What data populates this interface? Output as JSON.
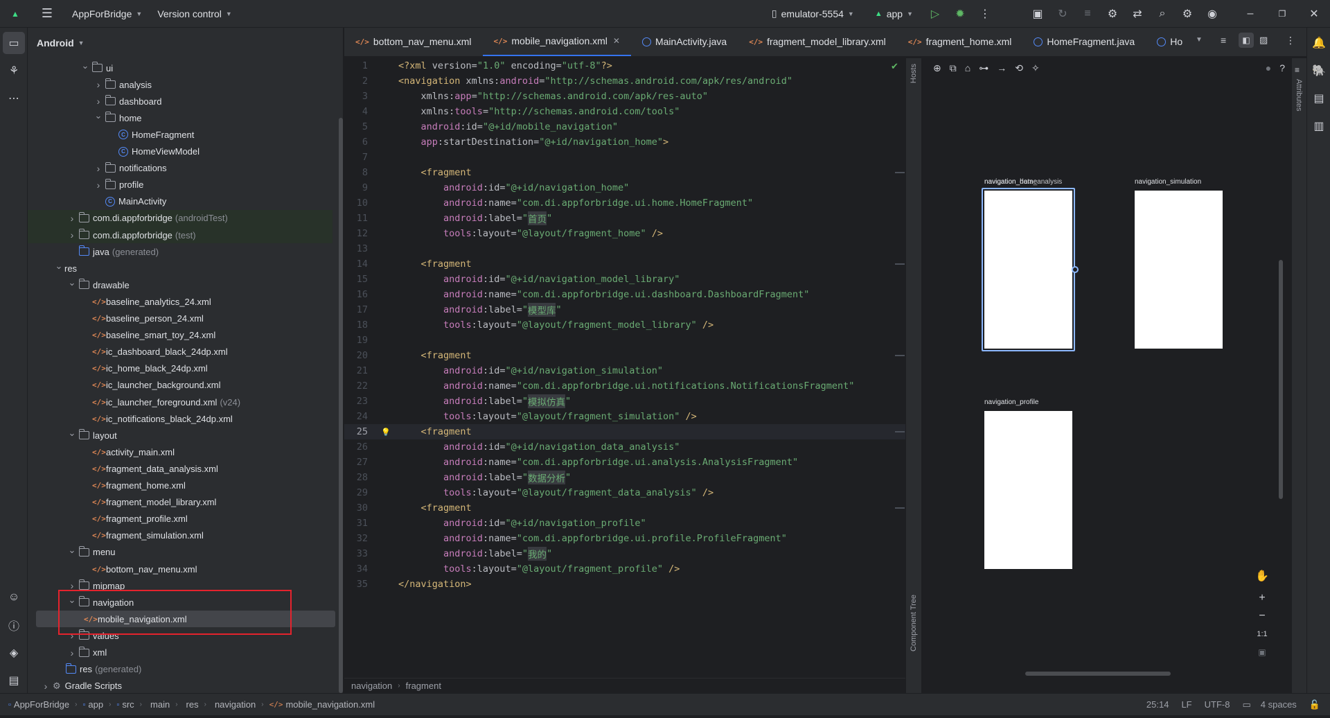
{
  "titlebar": {
    "project": "AppForBridge",
    "vcs": "Version control",
    "device": "emulator-5554",
    "run_config": "app"
  },
  "project_panel": {
    "view": "Android",
    "tree": [
      {
        "label": "ui",
        "level": 3,
        "kind": "folder",
        "state": "open"
      },
      {
        "label": "analysis",
        "level": 4,
        "kind": "folder",
        "state": "closed"
      },
      {
        "label": "dashboard",
        "level": 4,
        "kind": "folder",
        "state": "closed"
      },
      {
        "label": "home",
        "level": 4,
        "kind": "folder",
        "state": "open"
      },
      {
        "label": "HomeFragment",
        "level": 5,
        "kind": "class"
      },
      {
        "label": "HomeViewModel",
        "level": 5,
        "kind": "class"
      },
      {
        "label": "notifications",
        "level": 4,
        "kind": "folder",
        "state": "closed"
      },
      {
        "label": "profile",
        "level": 4,
        "kind": "folder",
        "state": "closed"
      },
      {
        "label": "MainActivity",
        "level": 4,
        "kind": "class"
      },
      {
        "label": "com.di.appforbridge",
        "suffix": "(androidTest)",
        "level": 2,
        "kind": "folder",
        "state": "closed",
        "green": true
      },
      {
        "label": "com.di.appforbridge",
        "suffix": "(test)",
        "level": 2,
        "kind": "folder",
        "state": "closed",
        "green": true
      },
      {
        "label": "java",
        "suffix": "(generated)",
        "level": 2,
        "kind": "folder-blue"
      },
      {
        "label": "res",
        "level": 1,
        "kind": "none",
        "state": "open"
      },
      {
        "label": "drawable",
        "level": 2,
        "kind": "folder",
        "state": "open"
      },
      {
        "label": "baseline_analytics_24.xml",
        "level": 3,
        "kind": "xml"
      },
      {
        "label": "baseline_person_24.xml",
        "level": 3,
        "kind": "xml"
      },
      {
        "label": "baseline_smart_toy_24.xml",
        "level": 3,
        "kind": "xml"
      },
      {
        "label": "ic_dashboard_black_24dp.xml",
        "level": 3,
        "kind": "xml"
      },
      {
        "label": "ic_home_black_24dp.xml",
        "level": 3,
        "kind": "xml"
      },
      {
        "label": "ic_launcher_background.xml",
        "level": 3,
        "kind": "xml"
      },
      {
        "label": "ic_launcher_foreground.xml",
        "suffix": "(v24)",
        "level": 3,
        "kind": "xml"
      },
      {
        "label": "ic_notifications_black_24dp.xml",
        "level": 3,
        "kind": "xml"
      },
      {
        "label": "layout",
        "level": 2,
        "kind": "folder",
        "state": "open"
      },
      {
        "label": "activity_main.xml",
        "level": 3,
        "kind": "xml"
      },
      {
        "label": "fragment_data_analysis.xml",
        "level": 3,
        "kind": "xml"
      },
      {
        "label": "fragment_home.xml",
        "level": 3,
        "kind": "xml"
      },
      {
        "label": "fragment_model_library.xml",
        "level": 3,
        "kind": "xml"
      },
      {
        "label": "fragment_profile.xml",
        "level": 3,
        "kind": "xml"
      },
      {
        "label": "fragment_simulation.xml",
        "level": 3,
        "kind": "xml"
      },
      {
        "label": "menu",
        "level": 2,
        "kind": "folder",
        "state": "open"
      },
      {
        "label": "bottom_nav_menu.xml",
        "level": 3,
        "kind": "xml"
      },
      {
        "label": "mipmap",
        "level": 2,
        "kind": "folder",
        "state": "closed"
      },
      {
        "label": "navigation",
        "level": 2,
        "kind": "folder",
        "state": "open"
      },
      {
        "label": "mobile_navigation.xml",
        "level": 3,
        "kind": "xml",
        "selected": true
      },
      {
        "label": "values",
        "level": 2,
        "kind": "folder",
        "state": "closed"
      },
      {
        "label": "xml",
        "level": 2,
        "kind": "folder",
        "state": "closed"
      },
      {
        "label": "res",
        "suffix": "(generated)",
        "level": 1,
        "kind": "folder-blue"
      },
      {
        "label": "Gradle Scripts",
        "level": 0,
        "kind": "gradle",
        "state": "closed"
      }
    ]
  },
  "editor": {
    "tabs": [
      {
        "label": "bottom_nav_menu.xml",
        "kind": "xml"
      },
      {
        "label": "mobile_navigation.xml",
        "kind": "xml",
        "active": true,
        "close": "✕"
      },
      {
        "label": "MainActivity.java",
        "kind": "class"
      },
      {
        "label": "fragment_model_library.xml",
        "kind": "xml"
      },
      {
        "label": "fragment_home.xml",
        "kind": "xml"
      },
      {
        "label": "HomeFragment.java",
        "kind": "class"
      },
      {
        "label": "Ho",
        "kind": "class"
      }
    ],
    "current_line": 25,
    "breadcrumb": [
      "navigation",
      "fragment"
    ]
  },
  "code_lines": [
    [
      [
        "tg",
        "<?xml "
      ],
      [
        "at",
        "version="
      ],
      [
        "st",
        "\"1.0\" "
      ],
      [
        "at",
        "encoding="
      ],
      [
        "st",
        "\"utf-8\""
      ],
      [
        "tg",
        "?>"
      ]
    ],
    [
      [
        "tg",
        "<navigation "
      ],
      [
        "at",
        "xmlns:"
      ],
      [
        "ns",
        "android"
      ],
      [
        "at",
        "="
      ],
      [
        "st",
        "\"http://schemas.android.com/apk/res/android\""
      ]
    ],
    [
      [
        "txt",
        "    "
      ],
      [
        "at",
        "xmlns:"
      ],
      [
        "ns",
        "app"
      ],
      [
        "at",
        "="
      ],
      [
        "st",
        "\"http://schemas.android.com/apk/res-auto\""
      ]
    ],
    [
      [
        "txt",
        "    "
      ],
      [
        "at",
        "xmlns:"
      ],
      [
        "ns",
        "tools"
      ],
      [
        "at",
        "="
      ],
      [
        "st",
        "\"http://schemas.android.com/tools\""
      ]
    ],
    [
      [
        "txt",
        "    "
      ],
      [
        "ns",
        "android"
      ],
      [
        "at",
        ":id="
      ],
      [
        "st",
        "\"@+id/mobile_navigation\""
      ]
    ],
    [
      [
        "txt",
        "    "
      ],
      [
        "ns",
        "app"
      ],
      [
        "at",
        ":startDestination="
      ],
      [
        "st",
        "\"@+id/navigation_home\""
      ],
      [
        "tg",
        ">"
      ]
    ],
    [],
    [
      [
        "txt",
        "    "
      ],
      [
        "tg",
        "<fragment"
      ]
    ],
    [
      [
        "txt",
        "        "
      ],
      [
        "ns",
        "android"
      ],
      [
        "at",
        ":id="
      ],
      [
        "st",
        "\"@+id/navigation_home\""
      ]
    ],
    [
      [
        "txt",
        "        "
      ],
      [
        "ns",
        "android"
      ],
      [
        "at",
        ":name="
      ],
      [
        "st",
        "\"com.di.appforbridge.ui.home.HomeFragment\""
      ]
    ],
    [
      [
        "txt",
        "        "
      ],
      [
        "ns",
        "android"
      ],
      [
        "at",
        ":label="
      ],
      [
        "st",
        "\""
      ],
      [
        "ch",
        "首页"
      ],
      [
        "st",
        "\""
      ]
    ],
    [
      [
        "txt",
        "        "
      ],
      [
        "ns",
        "tools"
      ],
      [
        "at",
        ":layout="
      ],
      [
        "st",
        "\"@layout/fragment_home\" "
      ],
      [
        "tg",
        "/>"
      ]
    ],
    [],
    [
      [
        "txt",
        "    "
      ],
      [
        "tg",
        "<fragment"
      ]
    ],
    [
      [
        "txt",
        "        "
      ],
      [
        "ns",
        "android"
      ],
      [
        "at",
        ":id="
      ],
      [
        "st",
        "\"@+id/navigation_model_library\""
      ]
    ],
    [
      [
        "txt",
        "        "
      ],
      [
        "ns",
        "android"
      ],
      [
        "at",
        ":name="
      ],
      [
        "st",
        "\"com.di.appforbridge.ui.dashboard.DashboardFragment\""
      ]
    ],
    [
      [
        "txt",
        "        "
      ],
      [
        "ns",
        "android"
      ],
      [
        "at",
        ":label="
      ],
      [
        "st",
        "\""
      ],
      [
        "ch",
        "模型库"
      ],
      [
        "st",
        "\""
      ]
    ],
    [
      [
        "txt",
        "        "
      ],
      [
        "ns",
        "tools"
      ],
      [
        "at",
        ":layout="
      ],
      [
        "st",
        "\"@layout/fragment_model_library\" "
      ],
      [
        "tg",
        "/>"
      ]
    ],
    [],
    [
      [
        "txt",
        "    "
      ],
      [
        "tg",
        "<fragment"
      ]
    ],
    [
      [
        "txt",
        "        "
      ],
      [
        "ns",
        "android"
      ],
      [
        "at",
        ":id="
      ],
      [
        "st",
        "\"@+id/navigation_simulation\""
      ]
    ],
    [
      [
        "txt",
        "        "
      ],
      [
        "ns",
        "android"
      ],
      [
        "at",
        ":name="
      ],
      [
        "st",
        "\"com.di.appforbridge.ui.notifications.NotificationsFragment\""
      ]
    ],
    [
      [
        "txt",
        "        "
      ],
      [
        "ns",
        "android"
      ],
      [
        "at",
        ":label="
      ],
      [
        "st",
        "\""
      ],
      [
        "ch",
        "模拟仿真"
      ],
      [
        "st",
        "\""
      ]
    ],
    [
      [
        "txt",
        "        "
      ],
      [
        "ns",
        "tools"
      ],
      [
        "at",
        ":layout="
      ],
      [
        "st",
        "\"@layout/fragment_simulation\" "
      ],
      [
        "tg",
        "/>"
      ]
    ],
    [
      [
        "txt",
        "    "
      ],
      [
        "tg",
        "<fragment"
      ]
    ],
    [
      [
        "txt",
        "        "
      ],
      [
        "ns",
        "android"
      ],
      [
        "at",
        ":id="
      ],
      [
        "st",
        "\"@+id/navigation_data_analysis\""
      ]
    ],
    [
      [
        "txt",
        "        "
      ],
      [
        "ns",
        "android"
      ],
      [
        "at",
        ":name="
      ],
      [
        "st",
        "\"com.di.appforbridge.ui.analysis.AnalysisFragment\""
      ]
    ],
    [
      [
        "txt",
        "        "
      ],
      [
        "ns",
        "android"
      ],
      [
        "at",
        ":label="
      ],
      [
        "st",
        "\""
      ],
      [
        "ch",
        "数据分析"
      ],
      [
        "st",
        "\""
      ]
    ],
    [
      [
        "txt",
        "        "
      ],
      [
        "ns",
        "tools"
      ],
      [
        "at",
        ":layout="
      ],
      [
        "st",
        "\"@layout/fragment_data_analysis\" "
      ],
      [
        "tg",
        "/>"
      ]
    ],
    [
      [
        "txt",
        "    "
      ],
      [
        "tg",
        "<fragment"
      ]
    ],
    [
      [
        "txt",
        "        "
      ],
      [
        "ns",
        "android"
      ],
      [
        "at",
        ":id="
      ],
      [
        "st",
        "\"@+id/navigation_profile\""
      ]
    ],
    [
      [
        "txt",
        "        "
      ],
      [
        "ns",
        "android"
      ],
      [
        "at",
        ":name="
      ],
      [
        "st",
        "\"com.di.appforbridge.ui.profile.ProfileFragment\""
      ]
    ],
    [
      [
        "txt",
        "        "
      ],
      [
        "ns",
        "android"
      ],
      [
        "at",
        ":label="
      ],
      [
        "st",
        "\""
      ],
      [
        "ch",
        "我的"
      ],
      [
        "st",
        "\""
      ]
    ],
    [
      [
        "txt",
        "        "
      ],
      [
        "ns",
        "tools"
      ],
      [
        "at",
        ":layout="
      ],
      [
        "st",
        "\"@layout/fragment_profile\" "
      ],
      [
        "tg",
        "/>"
      ]
    ],
    [
      [
        "tg",
        "</navigation>"
      ]
    ]
  ],
  "design": {
    "hosts_label": "Hosts",
    "component_tree_label": "Component Tree",
    "attributes_label": "Attributes",
    "destinations": [
      {
        "label": "navigation_home",
        "overlap_label": "navigation_data_analysis",
        "selected": true
      },
      {
        "label": "navigation_simulation"
      },
      {
        "label": "navigation_profile"
      }
    ],
    "zoom_label": "1:1"
  },
  "statusbar": {
    "path": [
      "AppForBridge",
      "app",
      "src",
      "main",
      "res",
      "navigation",
      "mobile_navigation.xml"
    ],
    "position": "25:14",
    "line_sep": "LF",
    "encoding": "UTF-8",
    "indent": "4 spaces"
  },
  "colors": {
    "accent": "#3574f0",
    "highlight_box": "#e5232d",
    "xml_icon": "#e08855",
    "class_icon": "#548af7"
  }
}
